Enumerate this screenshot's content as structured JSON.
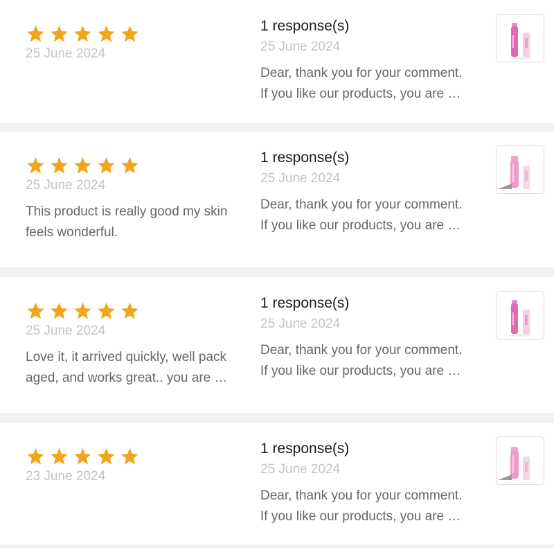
{
  "colors": {
    "star": "#f0a61a",
    "muted_text": "#c3c3c3",
    "body_text": "#666666",
    "title_text": "#1b1b1b",
    "product_pink": "#e06ab4"
  },
  "reviews": [
    {
      "rating": 5,
      "date": "25 June 2024",
      "comment": "",
      "response_count": "1 response(s)",
      "response_date": "25 June 2024",
      "response_text": "Dear, thank you for your comment. If you like our products, you are welcome to buy again.",
      "product_icon": "pink-spray-bottle"
    },
    {
      "rating": 5,
      "date": "25 June 2024",
      "comment": "This product is really good my skin feels wonderful.",
      "response_count": "1 response(s)",
      "response_date": "25 June 2024",
      "response_text": "Dear, thank you for your comment. If you like our products, you are welcome to buy again.",
      "product_icon": "pink-tube"
    },
    {
      "rating": 5,
      "date": "25 June 2024",
      "comment": "Love it, it arrived quickly, well packaged, and works great.. you are welcome to buy again.",
      "response_count": "1 response(s)",
      "response_date": "25 June 2024",
      "response_text": "Dear, thank you for your comment. If you like our products, you are welcome to buy again.",
      "product_icon": "pink-spray-bottle"
    },
    {
      "rating": 5,
      "date": "23 June 2024",
      "comment": "",
      "response_count": "1 response(s)",
      "response_date": "25 June 2024",
      "response_text": "Dear, thank you for your comment. If you like our products, you are welcome to buy again.",
      "product_icon": "pink-tube"
    }
  ]
}
